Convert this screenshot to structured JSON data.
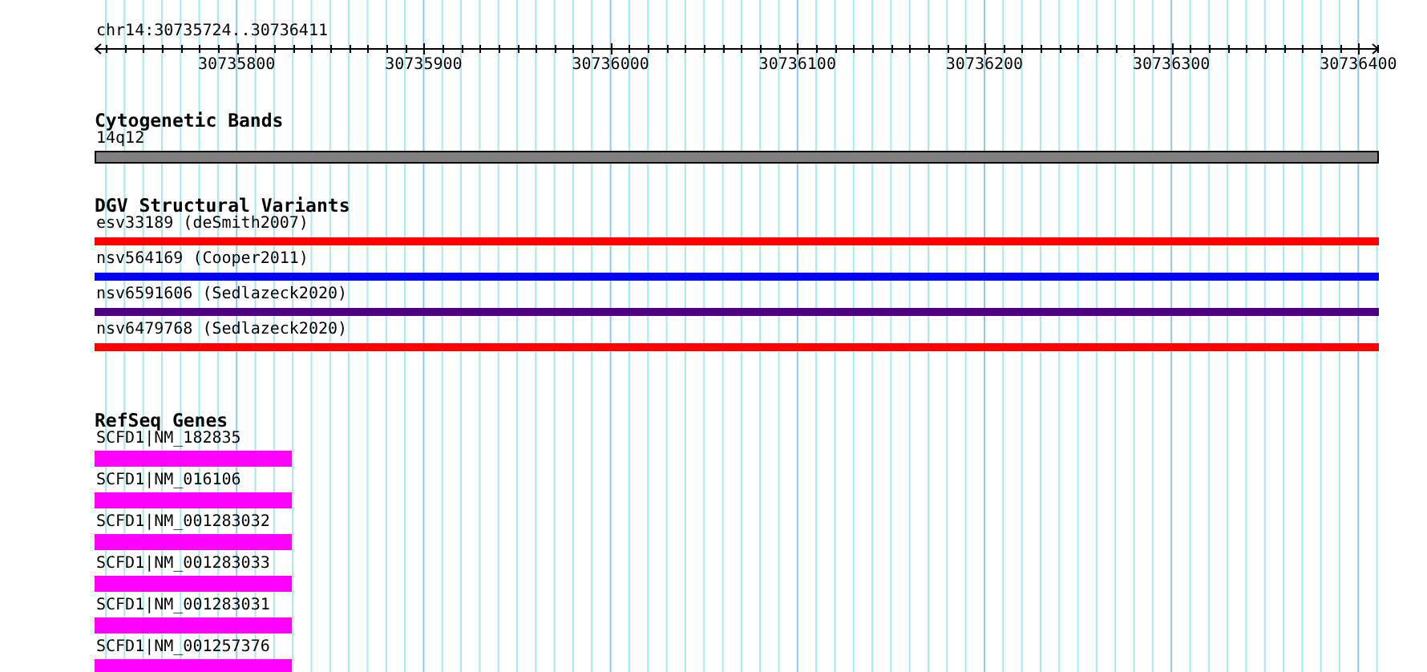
{
  "ruler": {
    "label": "chr14:30735724..30736411",
    "ticks": [
      "30735800",
      "30735900",
      "30736000",
      "30736100",
      "30736200",
      "30736300",
      "30736400"
    ]
  },
  "cytogenetic_bands": {
    "title": "Cytogenetic Bands",
    "bands": [
      {
        "label": "14q12"
      }
    ]
  },
  "dgv_structural_variants": {
    "title": "DGV Structural Variants",
    "variants": [
      {
        "label": "esv33189 (deSmith2007)",
        "color": "#ff0000"
      },
      {
        "label": "nsv564169 (Cooper2011)",
        "color": "#0000ff"
      },
      {
        "label": "nsv6591606 (Sedlazeck2020)",
        "color": "#4b0082"
      },
      {
        "label": "nsv6479768 (Sedlazeck2020)",
        "color": "#ff0000"
      }
    ]
  },
  "refseq_genes": {
    "title": "RefSeq Genes",
    "genes": [
      {
        "label": "SCFD1|NM_182835"
      },
      {
        "label": "SCFD1|NM_016106"
      },
      {
        "label": "SCFD1|NM_001283032"
      },
      {
        "label": "SCFD1|NM_001283033"
      },
      {
        "label": "SCFD1|NM_001283031"
      },
      {
        "label": "SCFD1|NM_001257376"
      }
    ]
  }
}
